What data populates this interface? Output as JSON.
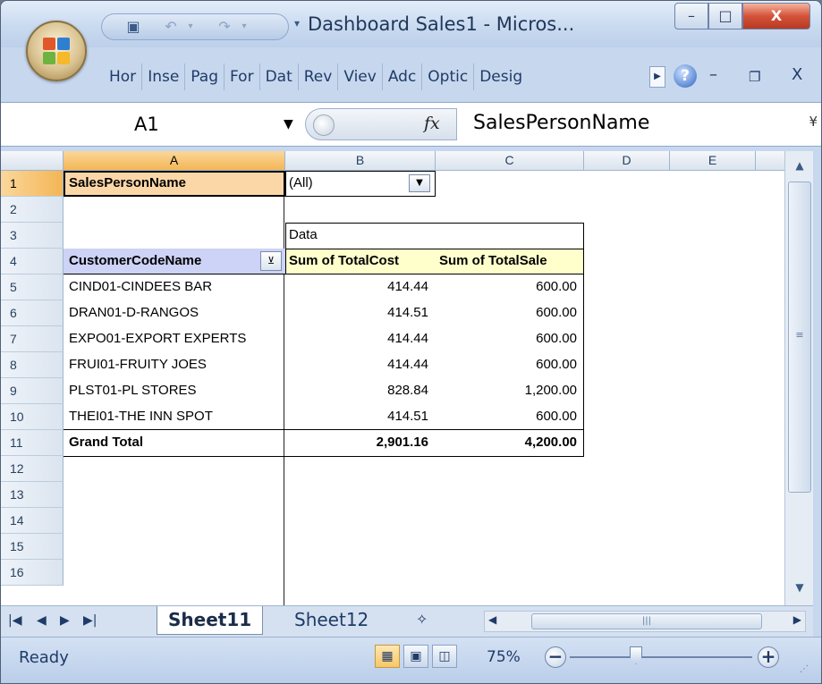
{
  "window": {
    "title": "Dashboard Sales1 - Micros...",
    "buttons": {
      "minimize": "–",
      "maximize": "□",
      "close": "X"
    }
  },
  "ribbon": {
    "tabs": [
      "Hor",
      "Inse",
      "Pag",
      "For",
      "Dat",
      "Rev",
      "Viev",
      "Adc",
      "Optic",
      "Desig"
    ],
    "help": "?",
    "mdi_min": "–",
    "mdi_restore": "❐",
    "mdi_close": "X"
  },
  "formula_bar": {
    "name_box": "A1",
    "fx": "fx",
    "formula": "SalesPersonName"
  },
  "columns": [
    "A",
    "B",
    "C",
    "D",
    "E"
  ],
  "rows": [
    "1",
    "2",
    "3",
    "4",
    "5",
    "6",
    "7",
    "8",
    "9",
    "10",
    "11",
    "12",
    "13",
    "14",
    "15",
    "16"
  ],
  "pivot": {
    "filter_label": "SalesPersonName",
    "filter_value": "(All)",
    "data_label": "Data",
    "row_header": "CustomerCodeName",
    "col_headers": [
      "Sum of TotalCost",
      "Sum of TotalSale"
    ],
    "rows": [
      {
        "name": "CIND01-CINDEES BAR",
        "cost": "414.44",
        "sale": "600.00"
      },
      {
        "name": "DRAN01-D-RANGOS",
        "cost": "414.51",
        "sale": "600.00"
      },
      {
        "name": "EXPO01-EXPORT EXPERTS",
        "cost": "414.44",
        "sale": "600.00"
      },
      {
        "name": "FRUI01-FRUITY JOES",
        "cost": "414.44",
        "sale": "600.00"
      },
      {
        "name": "PLST01-PL STORES",
        "cost": "828.84",
        "sale": "1,200.00"
      },
      {
        "name": "THEI01-THE INN SPOT",
        "cost": "414.51",
        "sale": "600.00"
      }
    ],
    "grand_total": {
      "name": "Grand Total",
      "cost": "2,901.16",
      "sale": "4,200.00"
    }
  },
  "sheets": {
    "tabs": [
      "Sheet11",
      "Sheet12"
    ],
    "active": "Sheet11"
  },
  "status": {
    "ready": "Ready",
    "zoom": "75%",
    "zoom_out": "−",
    "zoom_in": "+"
  }
}
